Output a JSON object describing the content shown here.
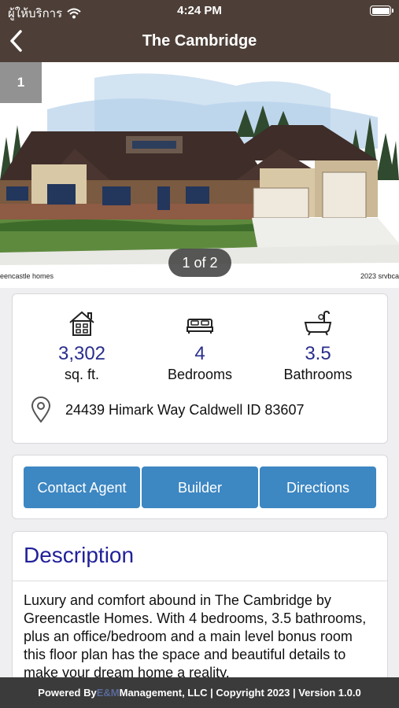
{
  "status_bar": {
    "carrier": "ผู้ให้บริการ",
    "time": "4:24 PM"
  },
  "nav": {
    "title": "The Cambridge"
  },
  "gallery": {
    "photo_number": "1",
    "counter": "1 of 2",
    "caption_left": "eencastle homes",
    "caption_right": "2023 srvbca"
  },
  "specs": {
    "sqft": {
      "value": "3,302",
      "label": "sq. ft."
    },
    "bedrooms": {
      "value": "4",
      "label": "Bedrooms"
    },
    "bathrooms": {
      "value": "3.5",
      "label": "Bathrooms"
    },
    "address": "24439 Himark Way Caldwell ID 83607"
  },
  "actions": {
    "contact": "Contact Agent",
    "builder": "Builder",
    "directions": "Directions"
  },
  "description": {
    "heading": "Description",
    "body": "Luxury and comfort abound in The Cambridge by Greencastle Homes. With 4 bedrooms, 3.5 bathrooms, plus an office/bedroom and a main level bonus room this floor plan has the space and beautiful details to make your dream home a reality."
  },
  "footer": {
    "prefix": "Powered By ",
    "brand": "E&M",
    "suffix": " Management, LLC | Copyright 2023 | Version 1.0.0"
  },
  "colors": {
    "nav_bg": "#4d3f37",
    "accent": "#3d87c2",
    "heading": "#21219a",
    "value": "#2a2e8c",
    "footer_bg": "#3b3b3b"
  }
}
